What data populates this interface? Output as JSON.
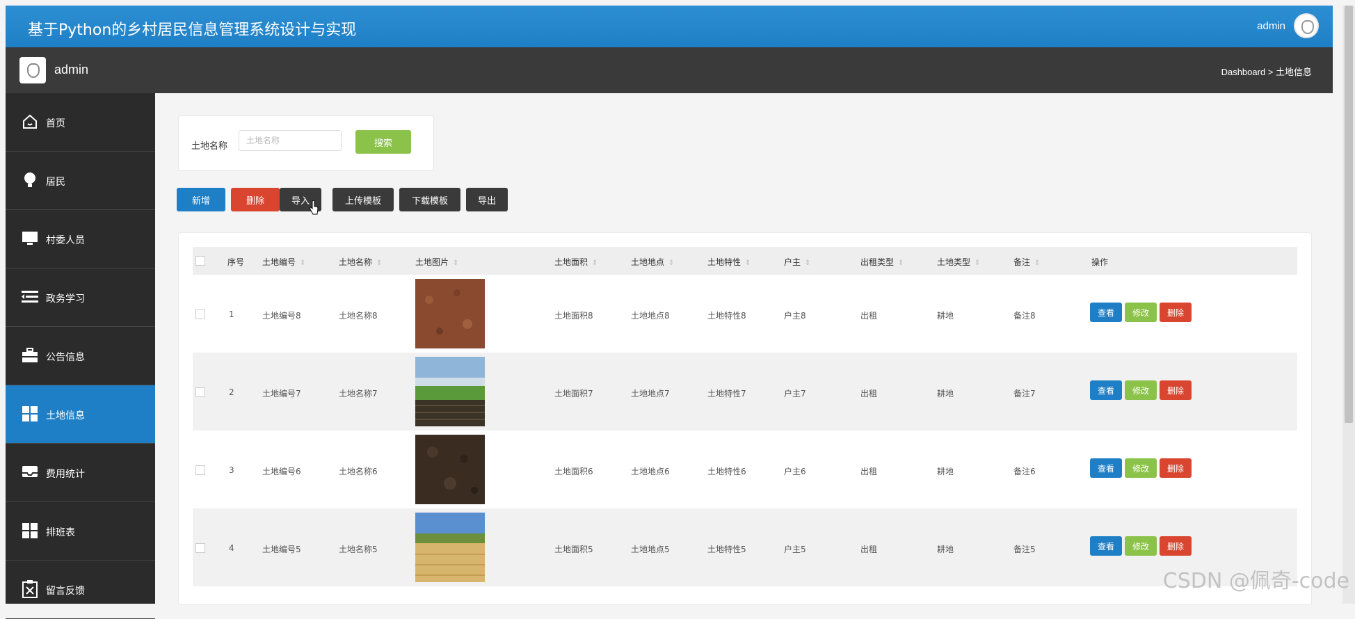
{
  "header": {
    "title": "基于Python的乡村居民信息管理系统设计与实现",
    "user": "admin"
  },
  "subheader": {
    "name": "admin",
    "breadcrumb": "Dashboard > 土地信息"
  },
  "sidebar": {
    "items": [
      {
        "label": "首页",
        "icon": "home-icon"
      },
      {
        "label": "居民",
        "icon": "bulb-icon"
      },
      {
        "label": "村委人员",
        "icon": "monitor-icon"
      },
      {
        "label": "政务学习",
        "icon": "menu-list-icon"
      },
      {
        "label": "公告信息",
        "icon": "briefcase-icon"
      },
      {
        "label": "土地信息",
        "icon": "grid-icon",
        "active": true
      },
      {
        "label": "费用统计",
        "icon": "inbox-icon"
      },
      {
        "label": "排班表",
        "icon": "grid-icon"
      },
      {
        "label": "留言反馈",
        "icon": "clipboard-x-icon"
      }
    ]
  },
  "search": {
    "label": "土地名称",
    "placeholder": "土地名称",
    "button": "搜索"
  },
  "toolbar": {
    "add": "新增",
    "delete": "删除",
    "import": "导入",
    "upload_template": "上传模板",
    "download_template": "下载模板",
    "export": "导出"
  },
  "table": {
    "columns": [
      "序号",
      "土地编号",
      "土地名称",
      "土地图片",
      "土地面积",
      "土地地点",
      "土地特性",
      "户主",
      "出租类型",
      "土地类型",
      "备注",
      "操作"
    ],
    "rows": [
      {
        "no": "1",
        "code": "土地编号8",
        "name": "土地名称8",
        "area": "土地面积8",
        "place": "土地地点8",
        "feature": "土地特性8",
        "owner": "户主8",
        "rent": "出租",
        "type": "耕地",
        "note": "备注8"
      },
      {
        "no": "2",
        "code": "土地编号7",
        "name": "土地名称7",
        "area": "土地面积7",
        "place": "土地地点7",
        "feature": "土地特性7",
        "owner": "户主7",
        "rent": "出租",
        "type": "耕地",
        "note": "备注7"
      },
      {
        "no": "3",
        "code": "土地编号6",
        "name": "土地名称6",
        "area": "土地面积6",
        "place": "土地地点6",
        "feature": "土地特性6",
        "owner": "户主6",
        "rent": "出租",
        "type": "耕地",
        "note": "备注6"
      },
      {
        "no": "4",
        "code": "土地编号5",
        "name": "土地名称5",
        "area": "土地面积5",
        "place": "土地地点5",
        "feature": "土地特性5",
        "owner": "户主5",
        "rent": "出租",
        "type": "耕地",
        "note": "备注5"
      }
    ],
    "actions": {
      "view": "查看",
      "edit": "修改",
      "delete": "删除"
    }
  },
  "watermark": "CSDN @佩奇-code"
}
